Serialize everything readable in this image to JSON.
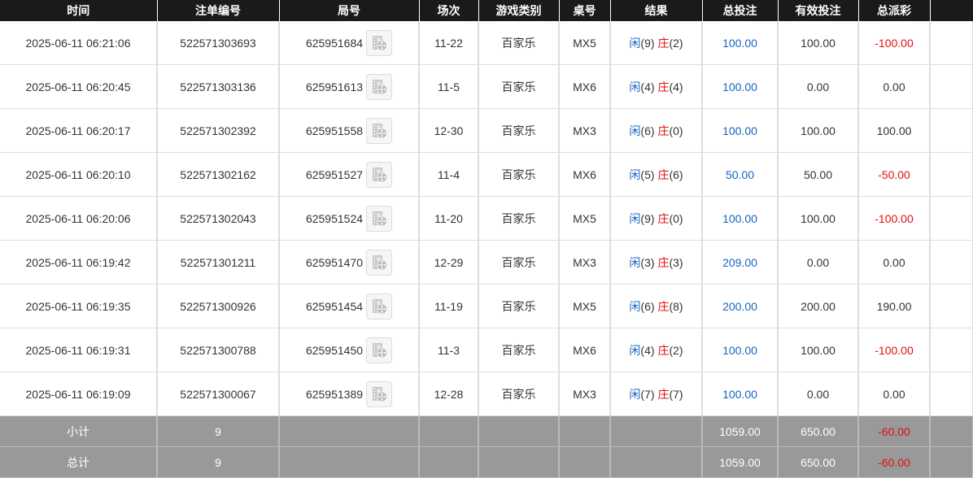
{
  "colors": {
    "header_bg": "#1a1a1a",
    "footer_bg": "#999999",
    "blue": "#1565c0",
    "red": "#e01010"
  },
  "icons": {
    "video": "film-reel-icon"
  },
  "table": {
    "columns": [
      "时间",
      "注单编号",
      "局号",
      "场次",
      "游戏类别",
      "桌号",
      "结果",
      "总投注",
      "有效投注",
      "总派彩",
      ""
    ],
    "rows": [
      {
        "time": "2025-06-11 06:21:06",
        "bet_no": "522571303693",
        "round_no": "625951684",
        "session": "11-22",
        "game": "百家乐",
        "table": "MX5",
        "player_label": "闲",
        "player_value": "(9)",
        "banker_label": "庄",
        "banker_value": "(2)",
        "total_bet": "100.00",
        "valid_bet": "100.00",
        "payout": "-100.00",
        "payout_negative": true
      },
      {
        "time": "2025-06-11 06:20:45",
        "bet_no": "522571303136",
        "round_no": "625951613",
        "session": "11-5",
        "game": "百家乐",
        "table": "MX6",
        "player_label": "闲",
        "player_value": "(4)",
        "banker_label": "庄",
        "banker_value": "(4)",
        "total_bet": "100.00",
        "valid_bet": "0.00",
        "payout": "0.00",
        "payout_negative": false
      },
      {
        "time": "2025-06-11 06:20:17",
        "bet_no": "522571302392",
        "round_no": "625951558",
        "session": "12-30",
        "game": "百家乐",
        "table": "MX3",
        "player_label": "闲",
        "player_value": "(6)",
        "banker_label": "庄",
        "banker_value": "(0)",
        "total_bet": "100.00",
        "valid_bet": "100.00",
        "payout": "100.00",
        "payout_negative": false
      },
      {
        "time": "2025-06-11 06:20:10",
        "bet_no": "522571302162",
        "round_no": "625951527",
        "session": "11-4",
        "game": "百家乐",
        "table": "MX6",
        "player_label": "闲",
        "player_value": "(5)",
        "banker_label": "庄",
        "banker_value": "(6)",
        "total_bet": "50.00",
        "valid_bet": "50.00",
        "payout": "-50.00",
        "payout_negative": true
      },
      {
        "time": "2025-06-11 06:20:06",
        "bet_no": "522571302043",
        "round_no": "625951524",
        "session": "11-20",
        "game": "百家乐",
        "table": "MX5",
        "player_label": "闲",
        "player_value": "(9)",
        "banker_label": "庄",
        "banker_value": "(0)",
        "total_bet": "100.00",
        "valid_bet": "100.00",
        "payout": "-100.00",
        "payout_negative": true
      },
      {
        "time": "2025-06-11 06:19:42",
        "bet_no": "522571301211",
        "round_no": "625951470",
        "session": "12-29",
        "game": "百家乐",
        "table": "MX3",
        "player_label": "闲",
        "player_value": "(3)",
        "banker_label": "庄",
        "banker_value": "(3)",
        "total_bet": "209.00",
        "valid_bet": "0.00",
        "payout": "0.00",
        "payout_negative": false
      },
      {
        "time": "2025-06-11 06:19:35",
        "bet_no": "522571300926",
        "round_no": "625951454",
        "session": "11-19",
        "game": "百家乐",
        "table": "MX5",
        "player_label": "闲",
        "player_value": "(6)",
        "banker_label": "庄",
        "banker_value": "(8)",
        "total_bet": "200.00",
        "valid_bet": "200.00",
        "payout": "190.00",
        "payout_negative": false
      },
      {
        "time": "2025-06-11 06:19:31",
        "bet_no": "522571300788",
        "round_no": "625951450",
        "session": "11-3",
        "game": "百家乐",
        "table": "MX6",
        "player_label": "闲",
        "player_value": "(4)",
        "banker_label": "庄",
        "banker_value": "(2)",
        "total_bet": "100.00",
        "valid_bet": "100.00",
        "payout": "-100.00",
        "payout_negative": true
      },
      {
        "time": "2025-06-11 06:19:09",
        "bet_no": "522571300067",
        "round_no": "625951389",
        "session": "12-28",
        "game": "百家乐",
        "table": "MX3",
        "player_label": "闲",
        "player_value": "(7)",
        "banker_label": "庄",
        "banker_value": "(7)",
        "total_bet": "100.00",
        "valid_bet": "0.00",
        "payout": "0.00",
        "payout_negative": false
      }
    ],
    "subtotal": {
      "label": "小计",
      "count": "9",
      "total_bet": "1059.00",
      "valid_bet": "650.00",
      "payout": "-60.00"
    },
    "grand_total": {
      "label": "总计",
      "count": "9",
      "total_bet": "1059.00",
      "valid_bet": "650.00",
      "payout": "-60.00"
    }
  }
}
